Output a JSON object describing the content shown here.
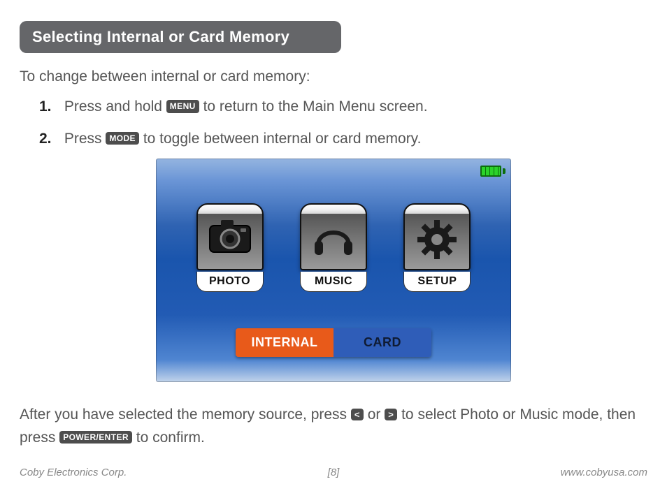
{
  "header": {
    "title": "Selecting Internal or Card Memory"
  },
  "intro": "To change between internal or card memory:",
  "steps": [
    {
      "num": "1.",
      "pre": "Press and hold ",
      "key": "MENU",
      "post": " to return to the Main Menu screen."
    },
    {
      "num": "2.",
      "pre": "Press ",
      "key": "MODE",
      "post": " to toggle between internal or card memory."
    }
  ],
  "device": {
    "battery_level": "full",
    "tiles": [
      {
        "id": "photo",
        "label": "PHOTO",
        "icon": "camera-icon"
      },
      {
        "id": "music",
        "label": "MUSIC",
        "icon": "headphones-icon"
      },
      {
        "id": "setup",
        "label": "SETUP",
        "icon": "gear-icon"
      }
    ],
    "memory": {
      "options": [
        {
          "label": "INTERNAL",
          "selected": true
        },
        {
          "label": "CARD",
          "selected": false
        }
      ]
    }
  },
  "after": {
    "t1": "After you have selected the memory source, press ",
    "key_left": "<",
    "t2": " or ",
    "key_right": ">",
    "t3": " to select  Photo or Music mode, then press ",
    "key_enter": "POWER/ENTER",
    "t4": " to confirm."
  },
  "footer": {
    "left": "Coby Electronics Corp.",
    "center": "[8]",
    "right": "www.cobyusa.com"
  }
}
